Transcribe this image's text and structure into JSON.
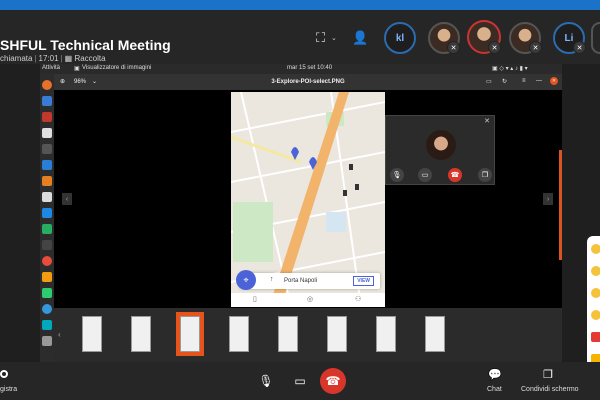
{
  "meeting": {
    "title": "SHFUL Technical Meeting",
    "call_label": "chiamata",
    "time": "17:01",
    "gallery_label": "Raccolta"
  },
  "participants": [
    {
      "kind": "initials",
      "initials": "kl"
    },
    {
      "kind": "photo"
    },
    {
      "kind": "photo"
    },
    {
      "kind": "photo"
    },
    {
      "kind": "initials",
      "initials": "Li"
    }
  ],
  "ubuntu_bar": {
    "activities": "Attività",
    "app_name": "Visualizzatore di immagini",
    "clock": "mar 15 set  10:40"
  },
  "viewer": {
    "file_name": "3-Explore-POI-select.PNG",
    "zoom": "96%"
  },
  "map_card": {
    "poi_name": "Porta Napoli",
    "view_label": "VIEW"
  },
  "thumbnails": {
    "count": 8,
    "selected_index": 2
  },
  "bottom_bar": {
    "record_label": "gistra",
    "chat_label": "Chat",
    "share_label": "Condividi schermo"
  },
  "colors": {
    "accent_blue": "#1a73c8",
    "end_call_red": "#d9362b",
    "selection_orange": "#e6541b",
    "map_primary": "#4b63d6"
  }
}
